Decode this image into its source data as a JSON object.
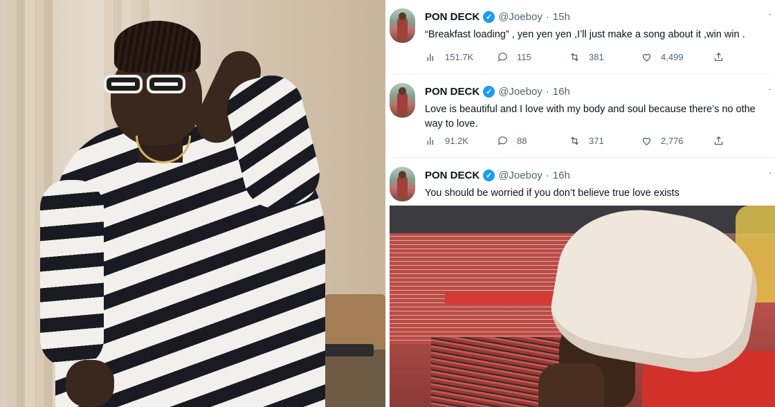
{
  "tweets": [
    {
      "name": "PON DECK",
      "handle": "@Joeboy",
      "dot": "·",
      "time": "15h",
      "text": "“Breakfast loading” , yen yen yen ,I’ll just make a song about it ,win win .",
      "views": "151.7K",
      "replies": "115",
      "retweets": "381",
      "likes": "4,499",
      "more": "·"
    },
    {
      "name": "PON DECK",
      "handle": "@Joeboy",
      "dot": "·",
      "time": "16h",
      "text_line1": "Love is beautiful and I love with my body and soul because there’s no othe",
      "text_line2": "way to love.",
      "views": "91.2K",
      "replies": "88",
      "retweets": "371",
      "likes": "2,776",
      "more": "·"
    },
    {
      "name": "PON DECK",
      "handle": "@Joeboy",
      "dot": "·",
      "time": "16h",
      "text": "You should be worried if you don’t believe true love exists",
      "more": "·"
    }
  ],
  "icons": {
    "verified": "verified-badge-icon",
    "views": "bar-chart-icon",
    "reply": "speech-bubble-icon",
    "retweet": "retweet-icon",
    "like": "heart-icon",
    "share": "share-upload-icon"
  },
  "colors": {
    "text": "#0f1419",
    "muted": "#536471",
    "verified": "#1d9bf0"
  }
}
